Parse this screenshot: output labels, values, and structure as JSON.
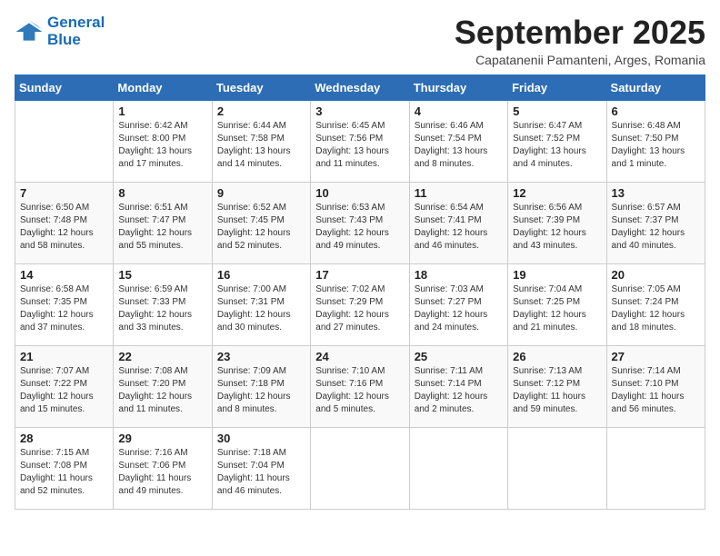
{
  "header": {
    "logo_line1": "General",
    "logo_line2": "Blue",
    "month": "September 2025",
    "location": "Capatanenii Pamanteni, Arges, Romania"
  },
  "days_of_week": [
    "Sunday",
    "Monday",
    "Tuesday",
    "Wednesday",
    "Thursday",
    "Friday",
    "Saturday"
  ],
  "weeks": [
    [
      {
        "day": "",
        "sunrise": "",
        "sunset": "",
        "daylight": ""
      },
      {
        "day": "1",
        "sunrise": "Sunrise: 6:42 AM",
        "sunset": "Sunset: 8:00 PM",
        "daylight": "Daylight: 13 hours and 17 minutes."
      },
      {
        "day": "2",
        "sunrise": "Sunrise: 6:44 AM",
        "sunset": "Sunset: 7:58 PM",
        "daylight": "Daylight: 13 hours and 14 minutes."
      },
      {
        "day": "3",
        "sunrise": "Sunrise: 6:45 AM",
        "sunset": "Sunset: 7:56 PM",
        "daylight": "Daylight: 13 hours and 11 minutes."
      },
      {
        "day": "4",
        "sunrise": "Sunrise: 6:46 AM",
        "sunset": "Sunset: 7:54 PM",
        "daylight": "Daylight: 13 hours and 8 minutes."
      },
      {
        "day": "5",
        "sunrise": "Sunrise: 6:47 AM",
        "sunset": "Sunset: 7:52 PM",
        "daylight": "Daylight: 13 hours and 4 minutes."
      },
      {
        "day": "6",
        "sunrise": "Sunrise: 6:48 AM",
        "sunset": "Sunset: 7:50 PM",
        "daylight": "Daylight: 13 hours and 1 minute."
      }
    ],
    [
      {
        "day": "7",
        "sunrise": "Sunrise: 6:50 AM",
        "sunset": "Sunset: 7:48 PM",
        "daylight": "Daylight: 12 hours and 58 minutes."
      },
      {
        "day": "8",
        "sunrise": "Sunrise: 6:51 AM",
        "sunset": "Sunset: 7:47 PM",
        "daylight": "Daylight: 12 hours and 55 minutes."
      },
      {
        "day": "9",
        "sunrise": "Sunrise: 6:52 AM",
        "sunset": "Sunset: 7:45 PM",
        "daylight": "Daylight: 12 hours and 52 minutes."
      },
      {
        "day": "10",
        "sunrise": "Sunrise: 6:53 AM",
        "sunset": "Sunset: 7:43 PM",
        "daylight": "Daylight: 12 hours and 49 minutes."
      },
      {
        "day": "11",
        "sunrise": "Sunrise: 6:54 AM",
        "sunset": "Sunset: 7:41 PM",
        "daylight": "Daylight: 12 hours and 46 minutes."
      },
      {
        "day": "12",
        "sunrise": "Sunrise: 6:56 AM",
        "sunset": "Sunset: 7:39 PM",
        "daylight": "Daylight: 12 hours and 43 minutes."
      },
      {
        "day": "13",
        "sunrise": "Sunrise: 6:57 AM",
        "sunset": "Sunset: 7:37 PM",
        "daylight": "Daylight: 12 hours and 40 minutes."
      }
    ],
    [
      {
        "day": "14",
        "sunrise": "Sunrise: 6:58 AM",
        "sunset": "Sunset: 7:35 PM",
        "daylight": "Daylight: 12 hours and 37 minutes."
      },
      {
        "day": "15",
        "sunrise": "Sunrise: 6:59 AM",
        "sunset": "Sunset: 7:33 PM",
        "daylight": "Daylight: 12 hours and 33 minutes."
      },
      {
        "day": "16",
        "sunrise": "Sunrise: 7:00 AM",
        "sunset": "Sunset: 7:31 PM",
        "daylight": "Daylight: 12 hours and 30 minutes."
      },
      {
        "day": "17",
        "sunrise": "Sunrise: 7:02 AM",
        "sunset": "Sunset: 7:29 PM",
        "daylight": "Daylight: 12 hours and 27 minutes."
      },
      {
        "day": "18",
        "sunrise": "Sunrise: 7:03 AM",
        "sunset": "Sunset: 7:27 PM",
        "daylight": "Daylight: 12 hours and 24 minutes."
      },
      {
        "day": "19",
        "sunrise": "Sunrise: 7:04 AM",
        "sunset": "Sunset: 7:25 PM",
        "daylight": "Daylight: 12 hours and 21 minutes."
      },
      {
        "day": "20",
        "sunrise": "Sunrise: 7:05 AM",
        "sunset": "Sunset: 7:24 PM",
        "daylight": "Daylight: 12 hours and 18 minutes."
      }
    ],
    [
      {
        "day": "21",
        "sunrise": "Sunrise: 7:07 AM",
        "sunset": "Sunset: 7:22 PM",
        "daylight": "Daylight: 12 hours and 15 minutes."
      },
      {
        "day": "22",
        "sunrise": "Sunrise: 7:08 AM",
        "sunset": "Sunset: 7:20 PM",
        "daylight": "Daylight: 12 hours and 11 minutes."
      },
      {
        "day": "23",
        "sunrise": "Sunrise: 7:09 AM",
        "sunset": "Sunset: 7:18 PM",
        "daylight": "Daylight: 12 hours and 8 minutes."
      },
      {
        "day": "24",
        "sunrise": "Sunrise: 7:10 AM",
        "sunset": "Sunset: 7:16 PM",
        "daylight": "Daylight: 12 hours and 5 minutes."
      },
      {
        "day": "25",
        "sunrise": "Sunrise: 7:11 AM",
        "sunset": "Sunset: 7:14 PM",
        "daylight": "Daylight: 12 hours and 2 minutes."
      },
      {
        "day": "26",
        "sunrise": "Sunrise: 7:13 AM",
        "sunset": "Sunset: 7:12 PM",
        "daylight": "Daylight: 11 hours and 59 minutes."
      },
      {
        "day": "27",
        "sunrise": "Sunrise: 7:14 AM",
        "sunset": "Sunset: 7:10 PM",
        "daylight": "Daylight: 11 hours and 56 minutes."
      }
    ],
    [
      {
        "day": "28",
        "sunrise": "Sunrise: 7:15 AM",
        "sunset": "Sunset: 7:08 PM",
        "daylight": "Daylight: 11 hours and 52 minutes."
      },
      {
        "day": "29",
        "sunrise": "Sunrise: 7:16 AM",
        "sunset": "Sunset: 7:06 PM",
        "daylight": "Daylight: 11 hours and 49 minutes."
      },
      {
        "day": "30",
        "sunrise": "Sunrise: 7:18 AM",
        "sunset": "Sunset: 7:04 PM",
        "daylight": "Daylight: 11 hours and 46 minutes."
      },
      {
        "day": "",
        "sunrise": "",
        "sunset": "",
        "daylight": ""
      },
      {
        "day": "",
        "sunrise": "",
        "sunset": "",
        "daylight": ""
      },
      {
        "day": "",
        "sunrise": "",
        "sunset": "",
        "daylight": ""
      },
      {
        "day": "",
        "sunrise": "",
        "sunset": "",
        "daylight": ""
      }
    ]
  ]
}
